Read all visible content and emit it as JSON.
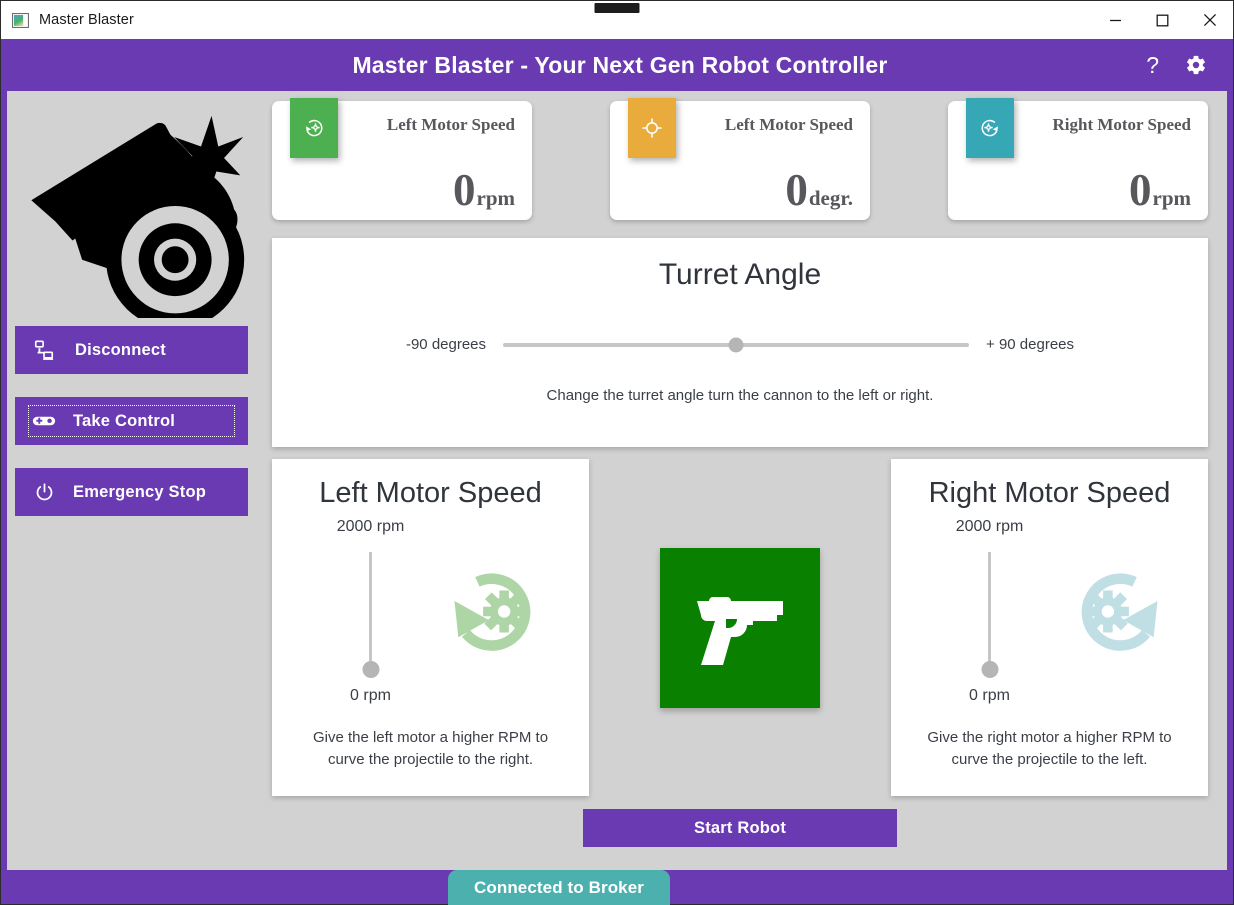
{
  "titlebar": {
    "app_name": "Master Blaster",
    "icon": "app-window-icon",
    "minimize_label": "minimize-icon",
    "maximize_label": "maximize-icon",
    "close_label": "close-icon"
  },
  "header": {
    "title": "Master Blaster - Your Next Gen Robot Controller",
    "help_label": "?",
    "settings_icon": "gear-icon",
    "background_color": "#6a3ab2"
  },
  "sidebar": {
    "logo_icon": "cannon-logo-icon",
    "buttons": [
      {
        "label": "Disconnect",
        "icon": "network-disconnect-icon",
        "focused": false
      },
      {
        "label": "Take Control",
        "icon": "gamepad-icon",
        "focused": true
      },
      {
        "label": "Emergency Stop",
        "icon": "power-icon",
        "focused": false
      }
    ]
  },
  "stat_cards": [
    {
      "label": "Left Motor Speed",
      "value": "0",
      "unit": "rpm",
      "icon": "rotate-left-gear-icon",
      "icon_color": "#4caf50"
    },
    {
      "label": "Left Motor Speed",
      "value": "0",
      "unit": "degr.",
      "icon": "crosshair-target-icon",
      "icon_color": "#e8ab3c"
    },
    {
      "label": "Right Motor Speed",
      "value": "0",
      "unit": "rpm",
      "icon": "rotate-right-gear-icon",
      "icon_color": "#36a7b5"
    }
  ],
  "turret": {
    "title": "Turret Angle",
    "min_label": "-90 degrees",
    "max_label": "+ 90 degrees",
    "hint": "Change the turret angle turn the cannon to the left or right.",
    "value_percent": 50
  },
  "left_motor": {
    "title": "Left Motor Speed",
    "max_label": "2000 rpm",
    "min_label": "0 rpm",
    "hint": "Give the left motor a higher RPM to curve the projectile to the right.",
    "value_percent": 0,
    "gear_icon": "rotate-left-gear-icon",
    "gear_color": "#aed5a5"
  },
  "right_motor": {
    "title": "Right Motor Speed",
    "max_label": "2000 rpm",
    "min_label": "0 rpm",
    "hint": "Give the right motor a higher RPM to curve the projectile to the left.",
    "value_percent": 0,
    "gear_icon": "rotate-right-gear-icon",
    "gear_color": "#bfdfe4"
  },
  "center": {
    "fire_icon": "pistol-icon",
    "fire_color": "#0a8000",
    "start_label": "Start Robot"
  },
  "statusbar": {
    "connection_label": "Connected to Broker",
    "badge_color": "#4bb0ae"
  }
}
